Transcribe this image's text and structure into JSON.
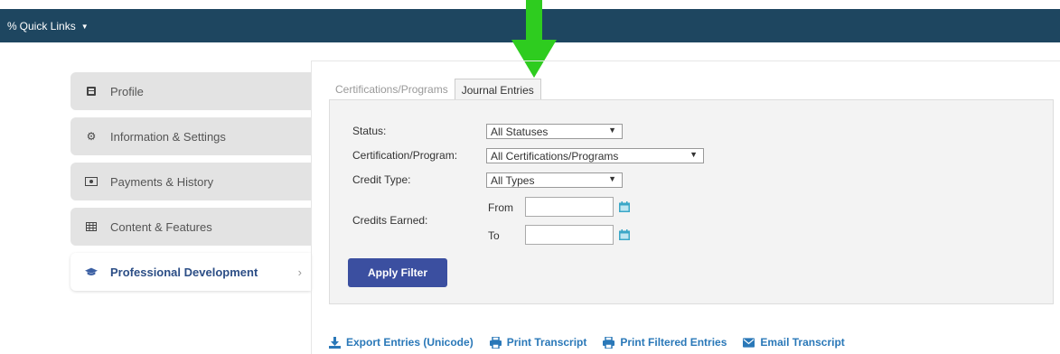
{
  "topbar": {
    "quick_links_label": "Quick Links"
  },
  "sidebar": {
    "items": [
      {
        "label": "Profile"
      },
      {
        "label": "Information & Settings"
      },
      {
        "label": "Payments & History"
      },
      {
        "label": "Content & Features"
      },
      {
        "label": "Professional Development",
        "chevron": "›"
      }
    ]
  },
  "tabs": [
    {
      "label": "Certifications/Programs"
    },
    {
      "label": "Journal Entries"
    }
  ],
  "filter": {
    "status_label": "Status:",
    "status_value": "All Statuses",
    "cert_label": "Certification/Program:",
    "cert_value": "All Certifications/Programs",
    "credit_type_label": "Credit Type:",
    "credit_type_value": "All Types",
    "credits_earned_label": "Credits Earned:",
    "from_label": "From",
    "to_label": "To",
    "apply_label": "Apply Filter"
  },
  "actions": {
    "export_label": "Export Entries (Unicode)",
    "print_transcript_label": "Print Transcript",
    "print_filtered_label": "Print Filtered Entries",
    "email_label": "Email Transcript"
  },
  "colors": {
    "topbar": "#1e4660",
    "arrow": "#2ecc1f",
    "apply_button": "#3b4fa0",
    "link": "#2a78b8"
  }
}
